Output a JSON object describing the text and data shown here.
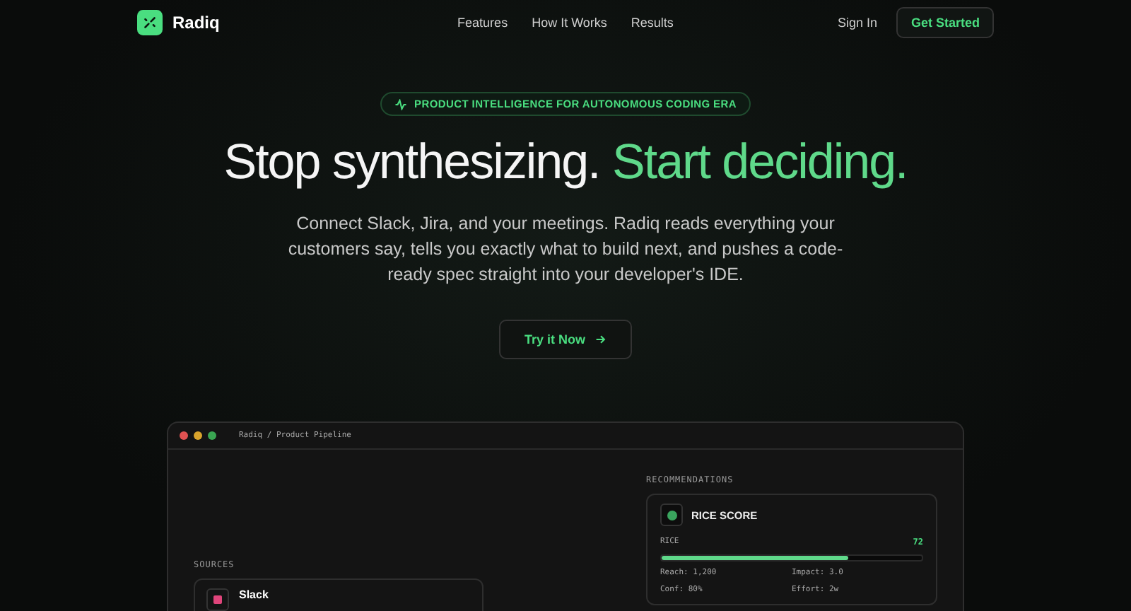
{
  "nav": {
    "brand": "Radiq",
    "links": [
      "Features",
      "How It Works",
      "Results"
    ],
    "sign_in": "Sign In",
    "cta": "Get Started"
  },
  "hero": {
    "badge": "PRODUCT INTELLIGENCE FOR AUTONOMOUS CODING ERA",
    "headline": "Stop synthesizing.",
    "headline_accent": "Start deciding.",
    "subtitle": "Connect Slack, Jira, and your meetings. Radiq reads everything your customers say, tells you exactly what to build next, and pushes a code-ready spec straight into your developer's IDE.",
    "button": "Try it Now"
  },
  "window": {
    "title": "Radiq / Product Pipeline",
    "sources": {
      "label": "SOURCES",
      "items": [
        {
          "name": "Slack",
          "color": "#e0457b"
        }
      ]
    },
    "recommendations": {
      "label": "RECOMMENDATIONS",
      "card": {
        "title": "RICE SCORE",
        "metric_label": "RICE",
        "score": "72",
        "level": 0.72,
        "stats": [
          "Reach: 1,200",
          "Impact: 3.0",
          "Conf: 80%",
          "Effort: 2w"
        ]
      }
    }
  }
}
